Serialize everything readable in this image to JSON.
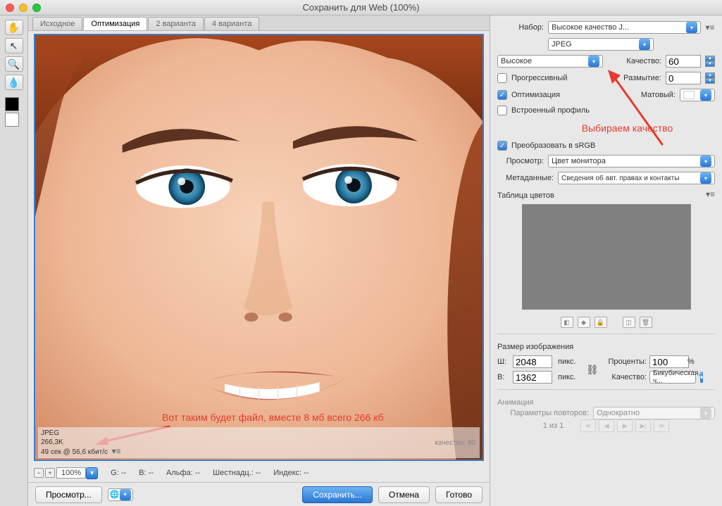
{
  "window": {
    "title": "Сохранить для Web (100%)"
  },
  "tabs": {
    "t0": "Исходное",
    "t1": "Оптимизация",
    "t2": "2 варианта",
    "t3": "4 варианта"
  },
  "preview": {
    "annotation": "Вот таким будет файл, вместе 8 мб всего 266 кб",
    "format": "JPEG",
    "size": "266,3K",
    "time": "49 сек @ 56,6 кбит/с",
    "quality_line": "качество: 60"
  },
  "bottombar": {
    "zoom": "100%",
    "g": "G: --",
    "b": "B: --",
    "alpha": "Альфа: --",
    "hex": "Шестнадц.: --",
    "index": "Индекс: --"
  },
  "actions": {
    "preview": "Просмотр...",
    "save": "Сохранить...",
    "cancel": "Отмена",
    "done": "Готово"
  },
  "panel": {
    "preset_label": "Набор:",
    "preset_value": "Высокое качество J...",
    "format": "JPEG",
    "quality_preset": "Высокое",
    "quality_label": "Качество:",
    "quality_value": "60",
    "progressive": "Прогрессивный",
    "blur_label": "Размытие:",
    "blur_value": "0",
    "optimized": "Оптимизация",
    "matte_label": "Матовый:",
    "embed_profile": "Встроенный профиль",
    "annotation": "Выбираем качество",
    "srgb": "Преобразовать в sRGB",
    "preview_label": "Просмотр:",
    "preview_value": "Цвет монитора",
    "metadata_label": "Метаданные:",
    "metadata_value": "Сведения об авт. правах и контакты",
    "color_table": "Таблица цветов",
    "image_size": "Размер изображения",
    "w_label": "Ш:",
    "w_value": "2048",
    "h_label": "В:",
    "h_value": "1362",
    "px": "пикс.",
    "percent_label": "Проценты:",
    "percent_value": "100",
    "percent_sym": "%",
    "resample_label": "Качество:",
    "resample_value": "Бикубическая, ч...",
    "animation": "Анимация",
    "loop_label": "Параметры повторов:",
    "loop_value": "Однократно",
    "frame": "1 из 1"
  }
}
